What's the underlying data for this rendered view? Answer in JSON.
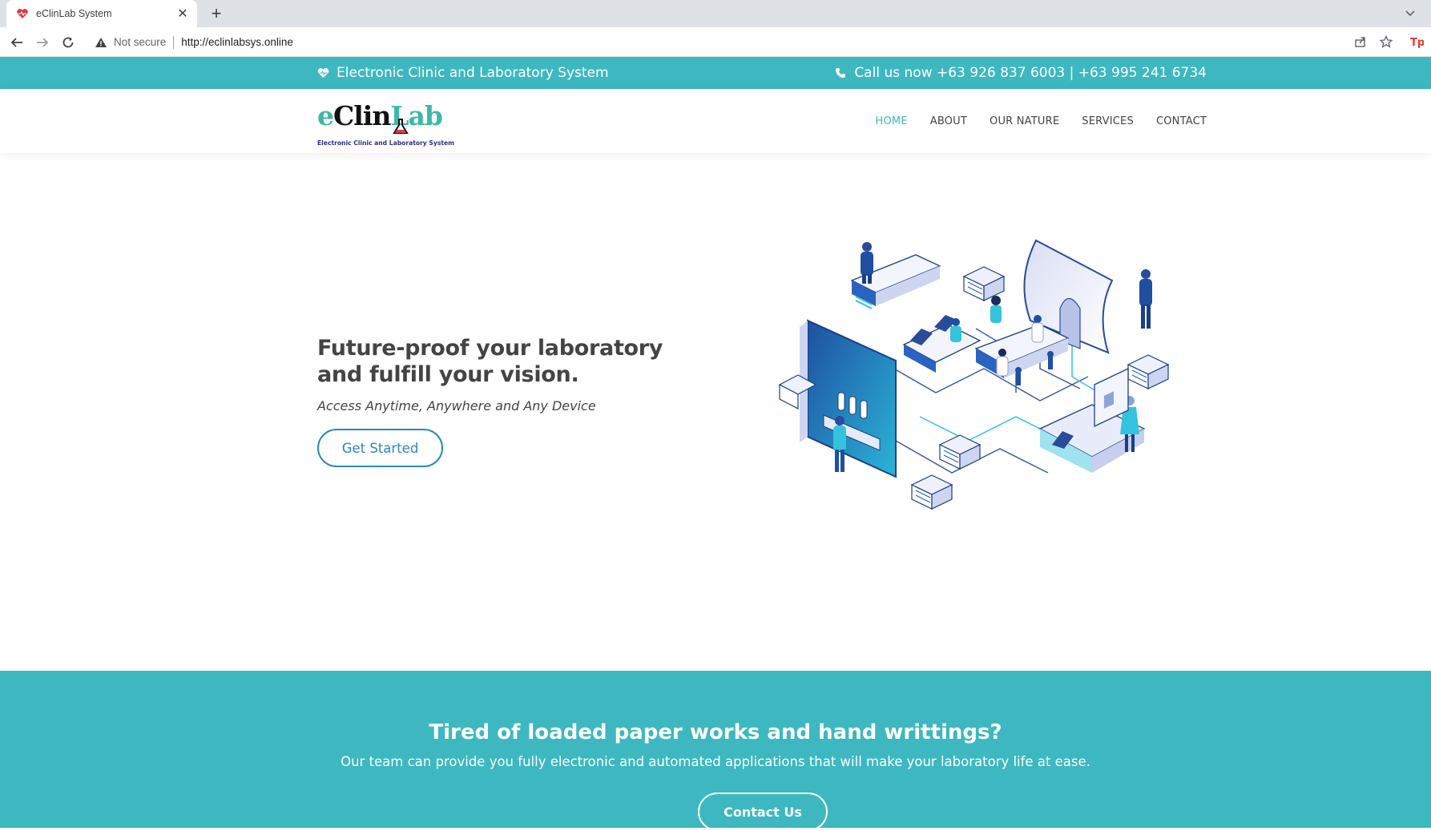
{
  "browser": {
    "tab_title": "eClinLab System",
    "security_label": "Not secure",
    "url": "http://eclinlabsys.online"
  },
  "topbar": {
    "tagline": "Electronic Clinic and Laboratory System",
    "phone": "Call us now +63 926 837 6003 | +63 995 241 6734"
  },
  "logo": {
    "part1": "e",
    "part2": "Clin",
    "part3": "Lab",
    "subtitle": "Electronic Clinic and Laboratory System"
  },
  "nav": {
    "items": [
      {
        "label": "HOME",
        "active": true
      },
      {
        "label": "ABOUT",
        "active": false
      },
      {
        "label": "OUR NATURE",
        "active": false
      },
      {
        "label": "SERVICES",
        "active": false
      },
      {
        "label": "CONTACT",
        "active": false
      }
    ]
  },
  "hero": {
    "title": "Future-proof your laboratory and fulfill your vision.",
    "subtitle": "Access Anytime, Anywhere and Any Device",
    "button": "Get Started"
  },
  "cta": {
    "heading": "Tired of loaded paper works and hand writtings?",
    "text": "Our team can provide you fully electronic and automated applications that will make your laboratory life at ease.",
    "button": "Contact Us"
  },
  "colors": {
    "accent": "#3db8c0",
    "button_blue": "#2e86c1",
    "text_dark": "#444444"
  }
}
